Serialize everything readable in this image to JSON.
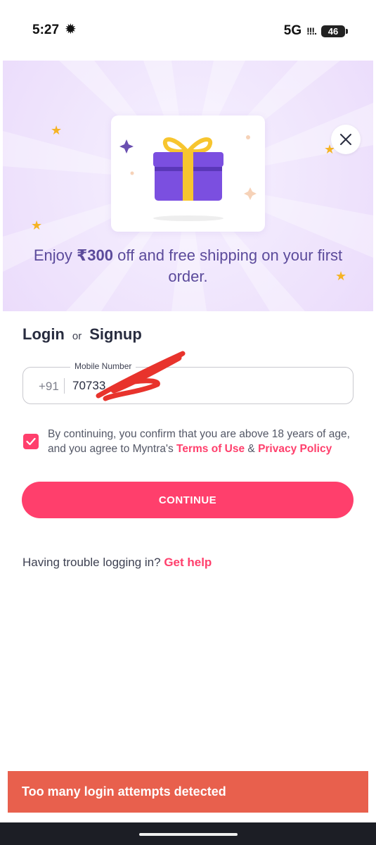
{
  "status_bar": {
    "time": "5:27",
    "time_glyph": "✹",
    "network": "5G",
    "signal": "!!!.",
    "battery": "46"
  },
  "banner": {
    "offer_prefix": "Enjoy ",
    "offer_amount": "₹300",
    "offer_suffix": " off and free shipping on your first order.",
    "close_icon": "close-icon",
    "colors": {
      "gift_box": "#7b4fe0",
      "gift_ribbon": "#f7c52f",
      "star": "#f5b324"
    }
  },
  "login": {
    "login_label": "Login",
    "or_label": "or",
    "signup_label": "Signup"
  },
  "mobile_field": {
    "label": "Mobile Number",
    "country_code": "+91",
    "value": "70733"
  },
  "consent": {
    "checked": true,
    "text_before": "By continuing, you confirm that you are above 18 years of age, and you agree to Myntra's ",
    "terms_link": "Terms of Use",
    "ampersand": " & ",
    "privacy_link": "Privacy Policy"
  },
  "continue_button": {
    "label": "CONTINUE"
  },
  "help": {
    "text": "Having trouble logging in? ",
    "link": "Get help"
  },
  "toast": {
    "message": "Too many login attempts detected"
  },
  "colors": {
    "accent": "#ff3f6c",
    "toast": "#e8604d",
    "heading": "#282c3f"
  }
}
